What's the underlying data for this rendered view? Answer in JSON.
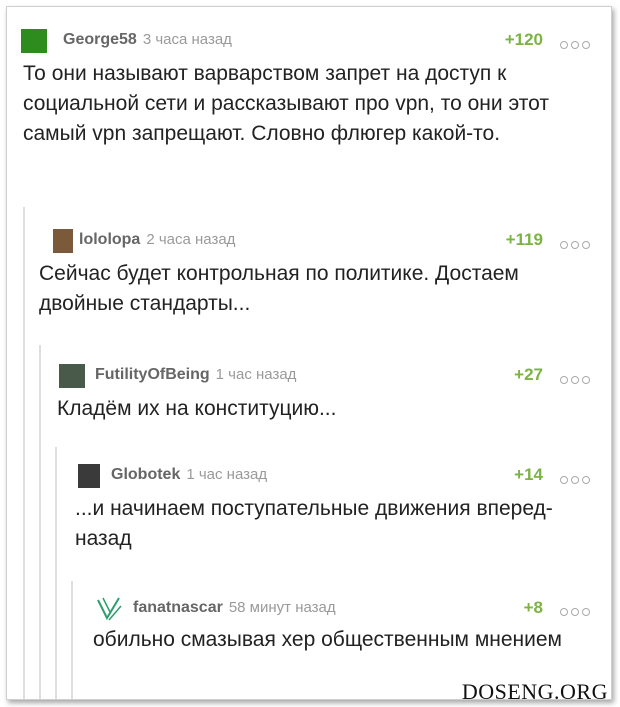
{
  "comments": [
    {
      "author": "George58",
      "time": "3 часа назад",
      "rating": "+120",
      "text": "То они называют варварством запрет на доступ к социальной сети и рассказывают про vpn, то они этот самый vpn запрещают. Словно флюгер какой-то.",
      "avatar_color": "#2e8b1e"
    },
    {
      "author": "lololopa",
      "time": "2 часа назад",
      "rating": "+119",
      "text": "Сейчас будет контрольная по политике. Достаем двойные стандарты...",
      "avatar_color": "#7a5a3a"
    },
    {
      "author": "FutilityOfBeing",
      "time": "1 час назад",
      "rating": "+27",
      "text": "Кладём их на конституцию...",
      "avatar_color": "#4a5a4a"
    },
    {
      "author": "Globotek",
      "time": "1 час назад",
      "rating": "+14",
      "text": "...и начинаем поступательные движения вперед-назад",
      "avatar_color": "#3a3a3a"
    },
    {
      "author": "fanatnascar",
      "time": "58 минут назад",
      "rating": "+8",
      "text": "обильно смазывая хер общественным мнением",
      "avatar_color": "#2e9e6e"
    }
  ],
  "watermark": "DOSENG.ORG",
  "colors": {
    "rating": "#7cb342",
    "author": "#666666",
    "time": "#9a9a9a",
    "thread_line": "#dedede"
  }
}
